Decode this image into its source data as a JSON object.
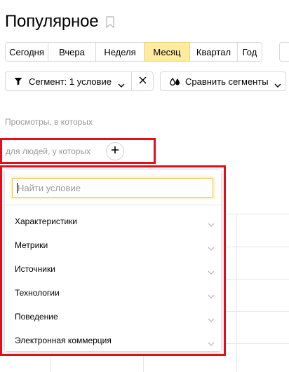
{
  "header": {
    "title": "Популярное"
  },
  "periods": [
    {
      "label": "Сегодня",
      "active": false
    },
    {
      "label": "Вчера",
      "active": false
    },
    {
      "label": "Неделя",
      "active": false
    },
    {
      "label": "Месяц",
      "active": true
    },
    {
      "label": "Квартал",
      "active": false
    },
    {
      "label": "Год",
      "active": false
    }
  ],
  "segment": {
    "label": "Сегмент: 1 условие",
    "compare_label": "Сравнить сегменты"
  },
  "conditions": {
    "views_label": "Просмотры, в которых",
    "people_label": "для людей, у которых"
  },
  "popup": {
    "search_placeholder": "Найти условие",
    "search_value": "",
    "categories": [
      {
        "label": "Характеристики"
      },
      {
        "label": "Метрики"
      },
      {
        "label": "Источники"
      },
      {
        "label": "Технологии"
      },
      {
        "label": "Поведение"
      },
      {
        "label": "Электронная коммерция"
      }
    ]
  },
  "colors": {
    "active_period": "#ffeba0",
    "highlight_frame": "#e0101e",
    "muted_text": "#999999"
  },
  "icons": [
    "bookmark-icon",
    "filter-icon",
    "chevron-down-icon",
    "close-icon",
    "compare-drops-icon",
    "plus-icon"
  ]
}
